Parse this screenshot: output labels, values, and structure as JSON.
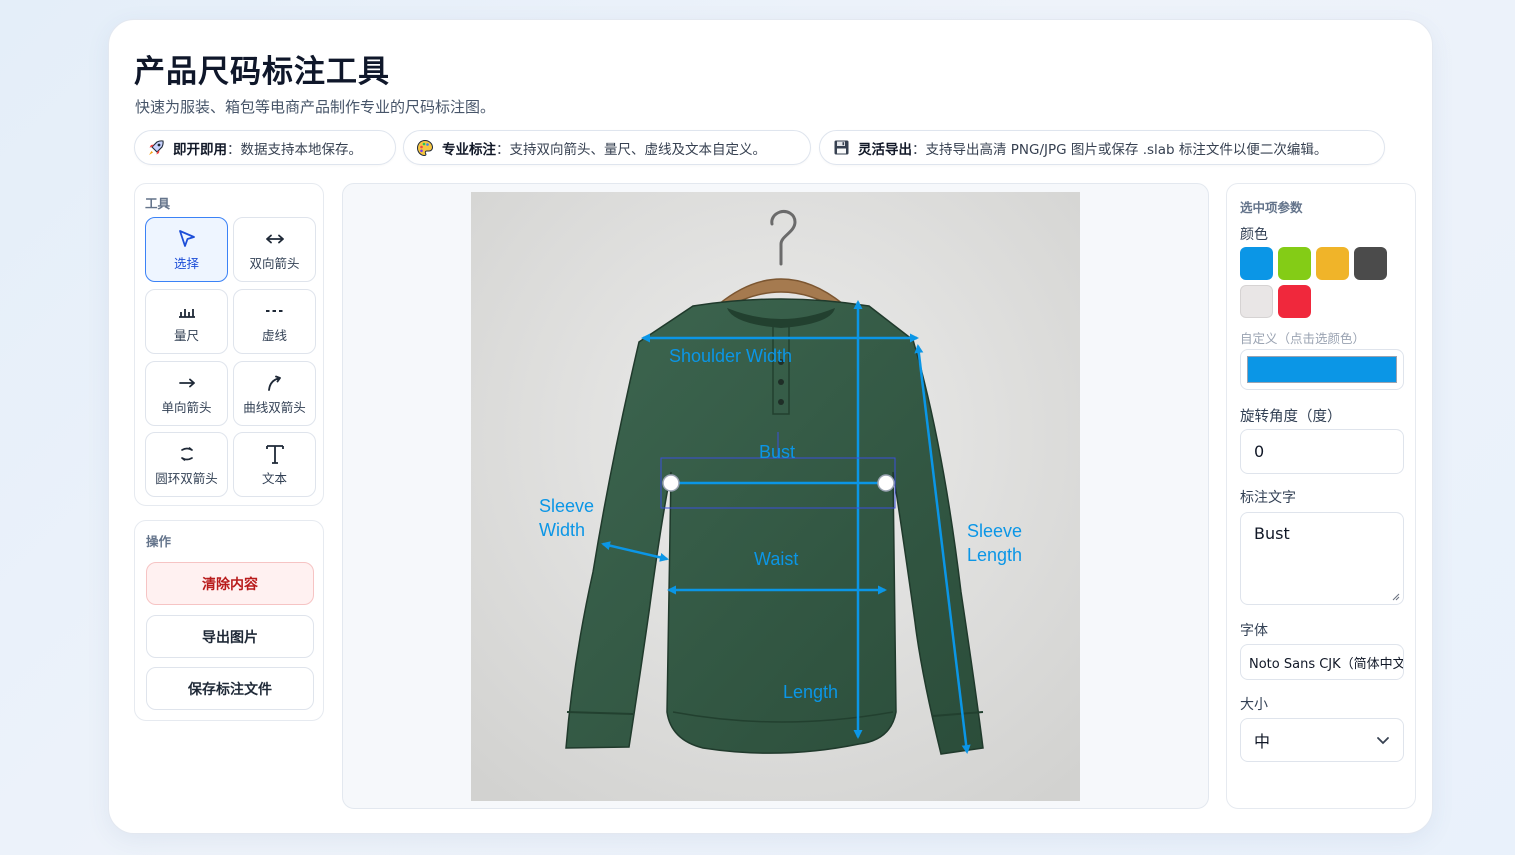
{
  "header": {
    "title": "产品尺码标注工具",
    "subtitle": "快速为服装、箱包等电商产品制作专业的尺码标注图。"
  },
  "features": [
    {
      "icon": "rocket-icon",
      "bold": "即开即用",
      "text": "：数据支持本地保存。"
    },
    {
      "icon": "palette-icon",
      "bold": "专业标注",
      "text": "：支持双向箭头、量尺、虚线及文本自定义。"
    },
    {
      "icon": "floppy-disk-icon",
      "bold": "灵活导出",
      "text": "：支持导出高清 PNG/JPG 图片或保存 .slab 标注文件以便二次编辑。"
    }
  ],
  "tools_panel": {
    "title": "工具",
    "tools": [
      {
        "label": "选择",
        "icon": "cursor-arrow-icon",
        "active": true
      },
      {
        "label": "双向箭头",
        "icon": "double-arrow-icon",
        "active": false
      },
      {
        "label": "量尺",
        "icon": "ruler-icon",
        "active": false
      },
      {
        "label": "虚线",
        "icon": "dashed-line-icon",
        "active": false
      },
      {
        "label": "单向箭头",
        "icon": "right-arrow-icon",
        "active": false
      },
      {
        "label": "曲线双箭头",
        "icon": "curved-arrow-icon",
        "active": false
      },
      {
        "label": "圆环双箭头",
        "icon": "ring-arrow-icon",
        "active": false
      },
      {
        "label": "文本",
        "icon": "text-t-icon",
        "active": false
      }
    ]
  },
  "actions_panel": {
    "title": "操作",
    "clear_label": "清除内容",
    "export_label": "导出图片",
    "save_label": "保存标注文件"
  },
  "canvas": {
    "annotation_color": "#0b96e6",
    "annotations": {
      "shoulder": "Shoulder Width",
      "bust": "Bust",
      "sleeve_width_1": "Sleeve",
      "sleeve_width_2": "Width",
      "waist": "Waist",
      "sleeve_length_1": "Sleeve",
      "sleeve_length_2": "Length",
      "length": "Length"
    }
  },
  "properties": {
    "title": "选中项参数",
    "color_label": "颜色",
    "swatches": [
      "#0b96e6",
      "#84cc16",
      "#f0b429",
      "#4b4b4b",
      "#e9e6e6",
      "#f0283c"
    ],
    "custom_label": "自定义（点击选颜色）",
    "custom_color": "#0b96e6",
    "rotation_label": "旋转角度（度）",
    "rotation_value": "0",
    "text_label": "标注文字",
    "text_value": "Bust",
    "font_label": "字体",
    "font_value": "Noto Sans CJK（简体中文）",
    "size_label": "大小",
    "size_value": "中"
  }
}
